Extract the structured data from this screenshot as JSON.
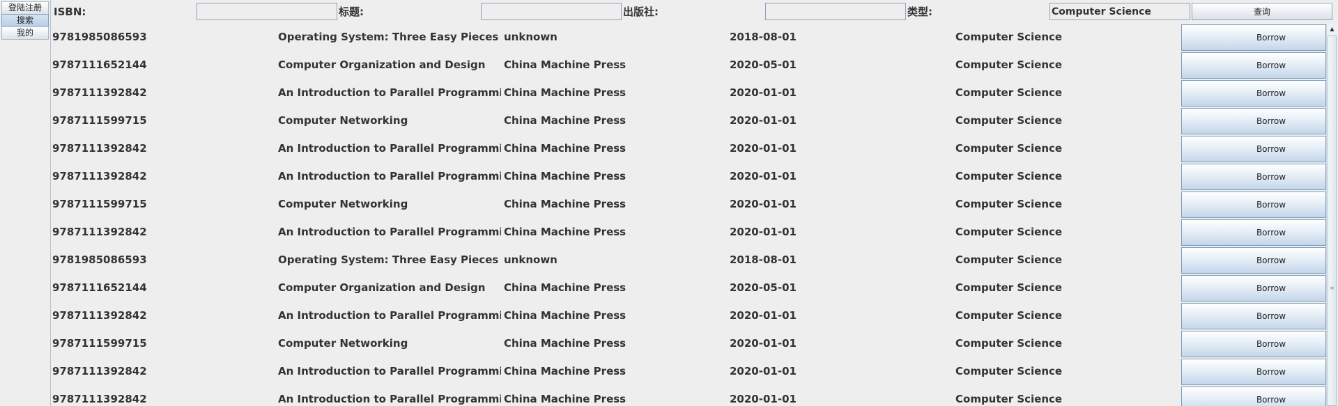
{
  "tabs": [
    {
      "label": "登陆注册",
      "selected": false
    },
    {
      "label": "搜索",
      "selected": true
    },
    {
      "label": "我的",
      "selected": false
    }
  ],
  "search": {
    "isbn_label": "ISBN:",
    "isbn_value": "",
    "title_label": "标题:",
    "title_value": "",
    "publisher_label": "出版社:",
    "publisher_value": "",
    "type_label": "类型:",
    "type_value": "Computer Science",
    "query_label": "查询"
  },
  "table": {
    "borrow_label": "Borrow",
    "rows": [
      {
        "isbn": "9781985086593",
        "title": "Operating System: Three Easy Pieces",
        "publisher": "unknown",
        "date": "2018-08-01",
        "type": "Computer Science"
      },
      {
        "isbn": "9787111652144",
        "title": "Computer Organization and Design",
        "publisher": "China Machine Press",
        "date": "2020-05-01",
        "type": "Computer Science"
      },
      {
        "isbn": "9787111392842",
        "title": "An Introduction to Parallel Programming",
        "publisher": "China Machine Press",
        "date": "2020-01-01",
        "type": "Computer Science"
      },
      {
        "isbn": "9787111599715",
        "title": "Computer Networking",
        "publisher": "China Machine Press",
        "date": "2020-01-01",
        "type": "Computer Science"
      },
      {
        "isbn": "9787111392842",
        "title": "An Introduction to Parallel Programming",
        "publisher": "China Machine Press",
        "date": "2020-01-01",
        "type": "Computer Science"
      },
      {
        "isbn": "9787111392842",
        "title": "An Introduction to Parallel Programming",
        "publisher": "China Machine Press",
        "date": "2020-01-01",
        "type": "Computer Science"
      },
      {
        "isbn": "9787111599715",
        "title": "Computer Networking",
        "publisher": "China Machine Press",
        "date": "2020-01-01",
        "type": "Computer Science"
      },
      {
        "isbn": "9787111392842",
        "title": "An Introduction to Parallel Programming",
        "publisher": "China Machine Press",
        "date": "2020-01-01",
        "type": "Computer Science"
      },
      {
        "isbn": "9781985086593",
        "title": "Operating System: Three Easy Pieces",
        "publisher": "unknown",
        "date": "2018-08-01",
        "type": "Computer Science"
      },
      {
        "isbn": "9787111652144",
        "title": "Computer Organization and Design",
        "publisher": "China Machine Press",
        "date": "2020-05-01",
        "type": "Computer Science"
      },
      {
        "isbn": "9787111392842",
        "title": "An Introduction to Parallel Programming",
        "publisher": "China Machine Press",
        "date": "2020-01-01",
        "type": "Computer Science"
      },
      {
        "isbn": "9787111599715",
        "title": "Computer Networking",
        "publisher": "China Machine Press",
        "date": "2020-01-01",
        "type": "Computer Science"
      },
      {
        "isbn": "9787111392842",
        "title": "An Introduction to Parallel Programming",
        "publisher": "China Machine Press",
        "date": "2020-01-01",
        "type": "Computer Science"
      },
      {
        "isbn": "9787111392842",
        "title": "An Introduction to Parallel Programming",
        "publisher": "China Machine Press",
        "date": "2020-01-01",
        "type": "Computer Science"
      }
    ]
  },
  "icons": {
    "scroll_up": "scroll-up-arrow-icon",
    "scroll_grip": "scroll-grip-icon"
  },
  "colors": {
    "background": "#eeeeee",
    "button_border": "#7f9db9",
    "selected_tab": "#b8cde6",
    "text": "#333333"
  }
}
